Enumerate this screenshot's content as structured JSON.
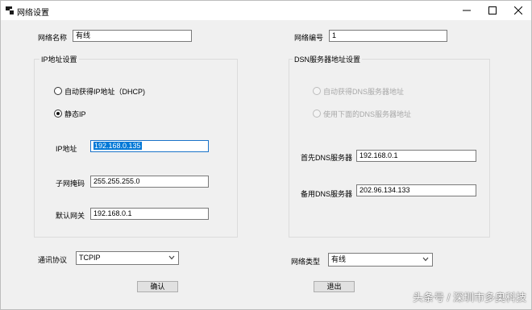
{
  "window": {
    "title": "网络设置",
    "icon": "app-window-icon",
    "controls": [
      "minimize-icon",
      "maximize-icon",
      "close-icon"
    ]
  },
  "fields": {
    "network_name_label": "网络名称",
    "network_name_value": "有线",
    "network_id_label": "网络编号",
    "network_id_value": "1"
  },
  "ip_group": {
    "title": "IP地址设置",
    "auto_option": "自动获得IP地址（DHCP)",
    "static_option": "静态IP",
    "selected": "static",
    "ip_label": "IP地址",
    "ip_value": "192.168.0.135",
    "mask_label": "子网掩码",
    "mask_value": "255.255.255.0",
    "gateway_label": "默认网关",
    "gateway_value": "192.168.0.1"
  },
  "dns_group": {
    "title": "DSN服务器地址设置",
    "auto_option": "自动获得DNS服务器地址",
    "manual_option": "使用下面的DNS服务器地址",
    "preferred_label": "首先DNS服务器",
    "preferred_value": "192.168.0.1",
    "alternate_label": "备用DNS服务器",
    "alternate_value": "202.96.134.133"
  },
  "bottom": {
    "protocol_label": "通讯协议",
    "protocol_value": "TCPIP",
    "net_type_label": "网络类型",
    "net_type_value": "有线",
    "confirm_label": "确认",
    "exit_label": "退出"
  },
  "watermark": "头条号 / 深圳市多奥科技",
  "colors": {
    "window_bg": "#f0f0f0",
    "selection": "#0078d7",
    "border": "#7a7a7a"
  }
}
